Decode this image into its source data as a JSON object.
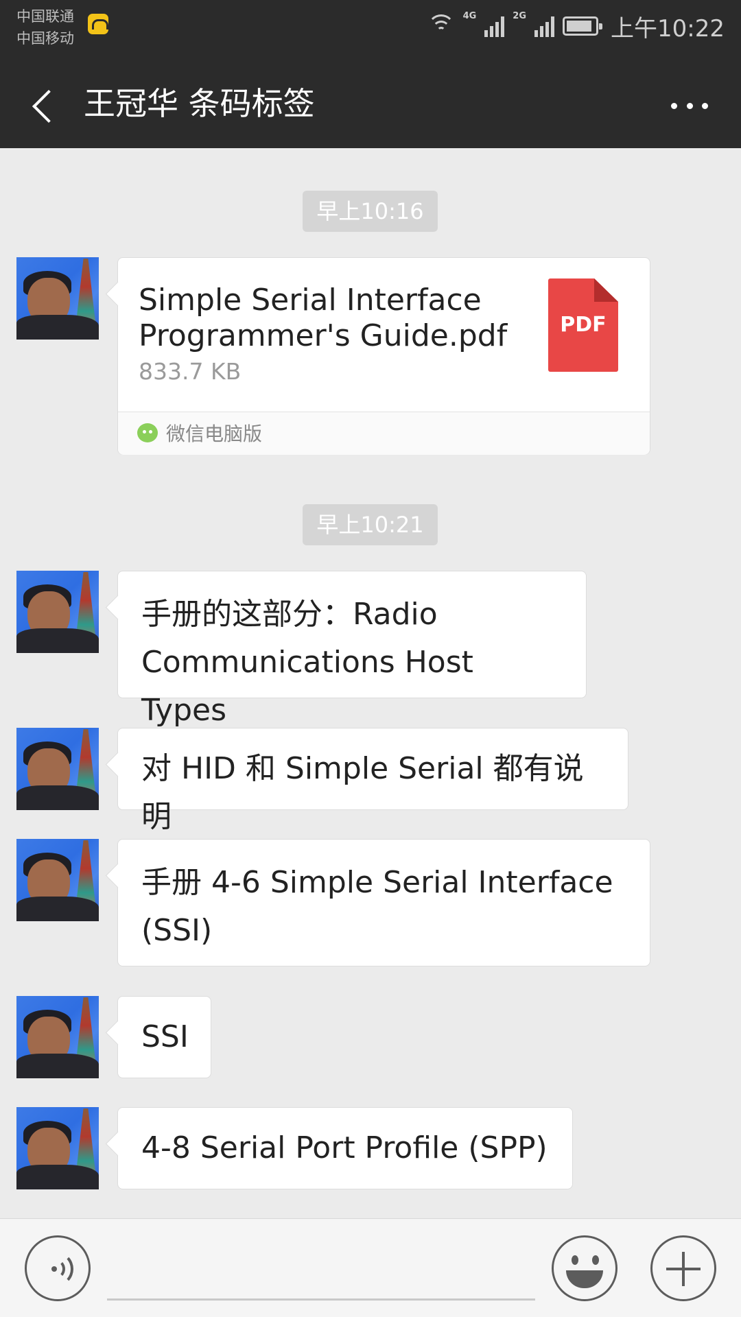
{
  "status_bar": {
    "carrier_1": "中国联通",
    "carrier_2": "中国移动",
    "network_1": "4G",
    "network_2": "2G",
    "time": "上午10:22"
  },
  "header": {
    "title": "王冠华 条码标签"
  },
  "messages": [
    {
      "type": "timestamp",
      "text": "早上10:16"
    },
    {
      "type": "file",
      "file_name": "Simple Serial Interface Programmer's Guide.pdf",
      "file_size": "833.7 KB",
      "file_type_label": "PDF",
      "source": "微信电脑版"
    },
    {
      "type": "timestamp",
      "text": "早上10:21"
    },
    {
      "type": "text",
      "text": "手册的这部分：Radio Communications Host Types"
    },
    {
      "type": "text",
      "text": "对 HID 和 Simple Serial 都有说明"
    },
    {
      "type": "text",
      "text": "手册 4-6  Simple Serial Interface (SSI)"
    },
    {
      "type": "text",
      "text": "SSI"
    },
    {
      "type": "text",
      "text": "4-8  Serial Port Profile (SPP)"
    }
  ],
  "input_bar": {
    "icons": [
      "voice-icon",
      "emoji-icon",
      "plus-icon"
    ]
  }
}
